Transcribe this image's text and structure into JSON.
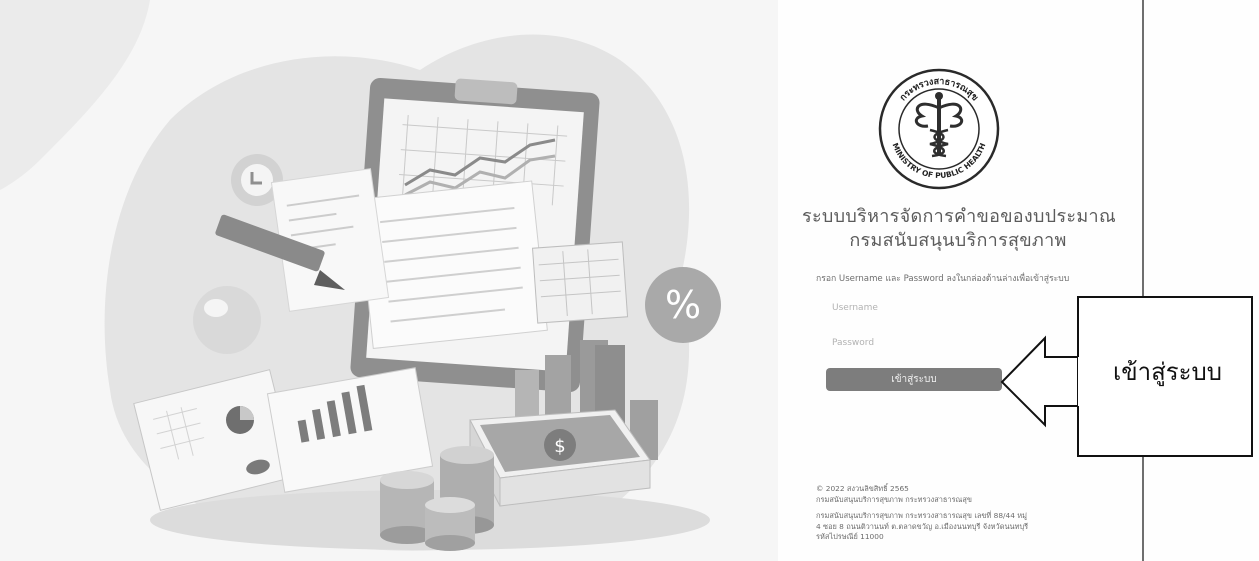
{
  "login": {
    "title_line1": "ระบบบริหารจัดการคำขอของบประมาณ",
    "title_line2": "กรมสนับสนุนบริการสุขภาพ",
    "instruction": "กรอก Username และ Password ลงในกล่องด้านล่างเพื่อเข้าสู่ระบบ",
    "username_placeholder": "Username",
    "password_placeholder": "Password",
    "login_button": "เข้าสู่ระบบ"
  },
  "logo": {
    "top_text": "กระทรวงสาธารณสุข",
    "bottom_text": "MINISTRY OF PUBLIC HEALTH"
  },
  "footer": {
    "copyright_line1": "© 2022 สงวนลิขสิทธิ์ 2565",
    "copyright_line2": "กรมสนับสนุนบริการสุขภาพ กระทรวงสาธารณสุข",
    "address_line1": "กรมสนับสนุนบริการสุขภาพ กระทรวงสาธารณสุข เลขที่ 88/44 หมู่",
    "address_line2": "4 ซอย 8 ถนนติวานนท์ ต.ตลาดขวัญ อ.เมืองนนทบุรี จังหวัดนนทบุรี",
    "address_line3": "รหัสไปรษณีย์ 11000"
  },
  "illustration": {
    "percent_symbol": "%",
    "dollar_symbol": "$"
  },
  "annotation": {
    "label": "เข้าสู่ระบบ"
  },
  "colors": {
    "button": "#7d7d7d",
    "title_text": "#5b5b5b",
    "panel_border": "#6f6f6f"
  }
}
